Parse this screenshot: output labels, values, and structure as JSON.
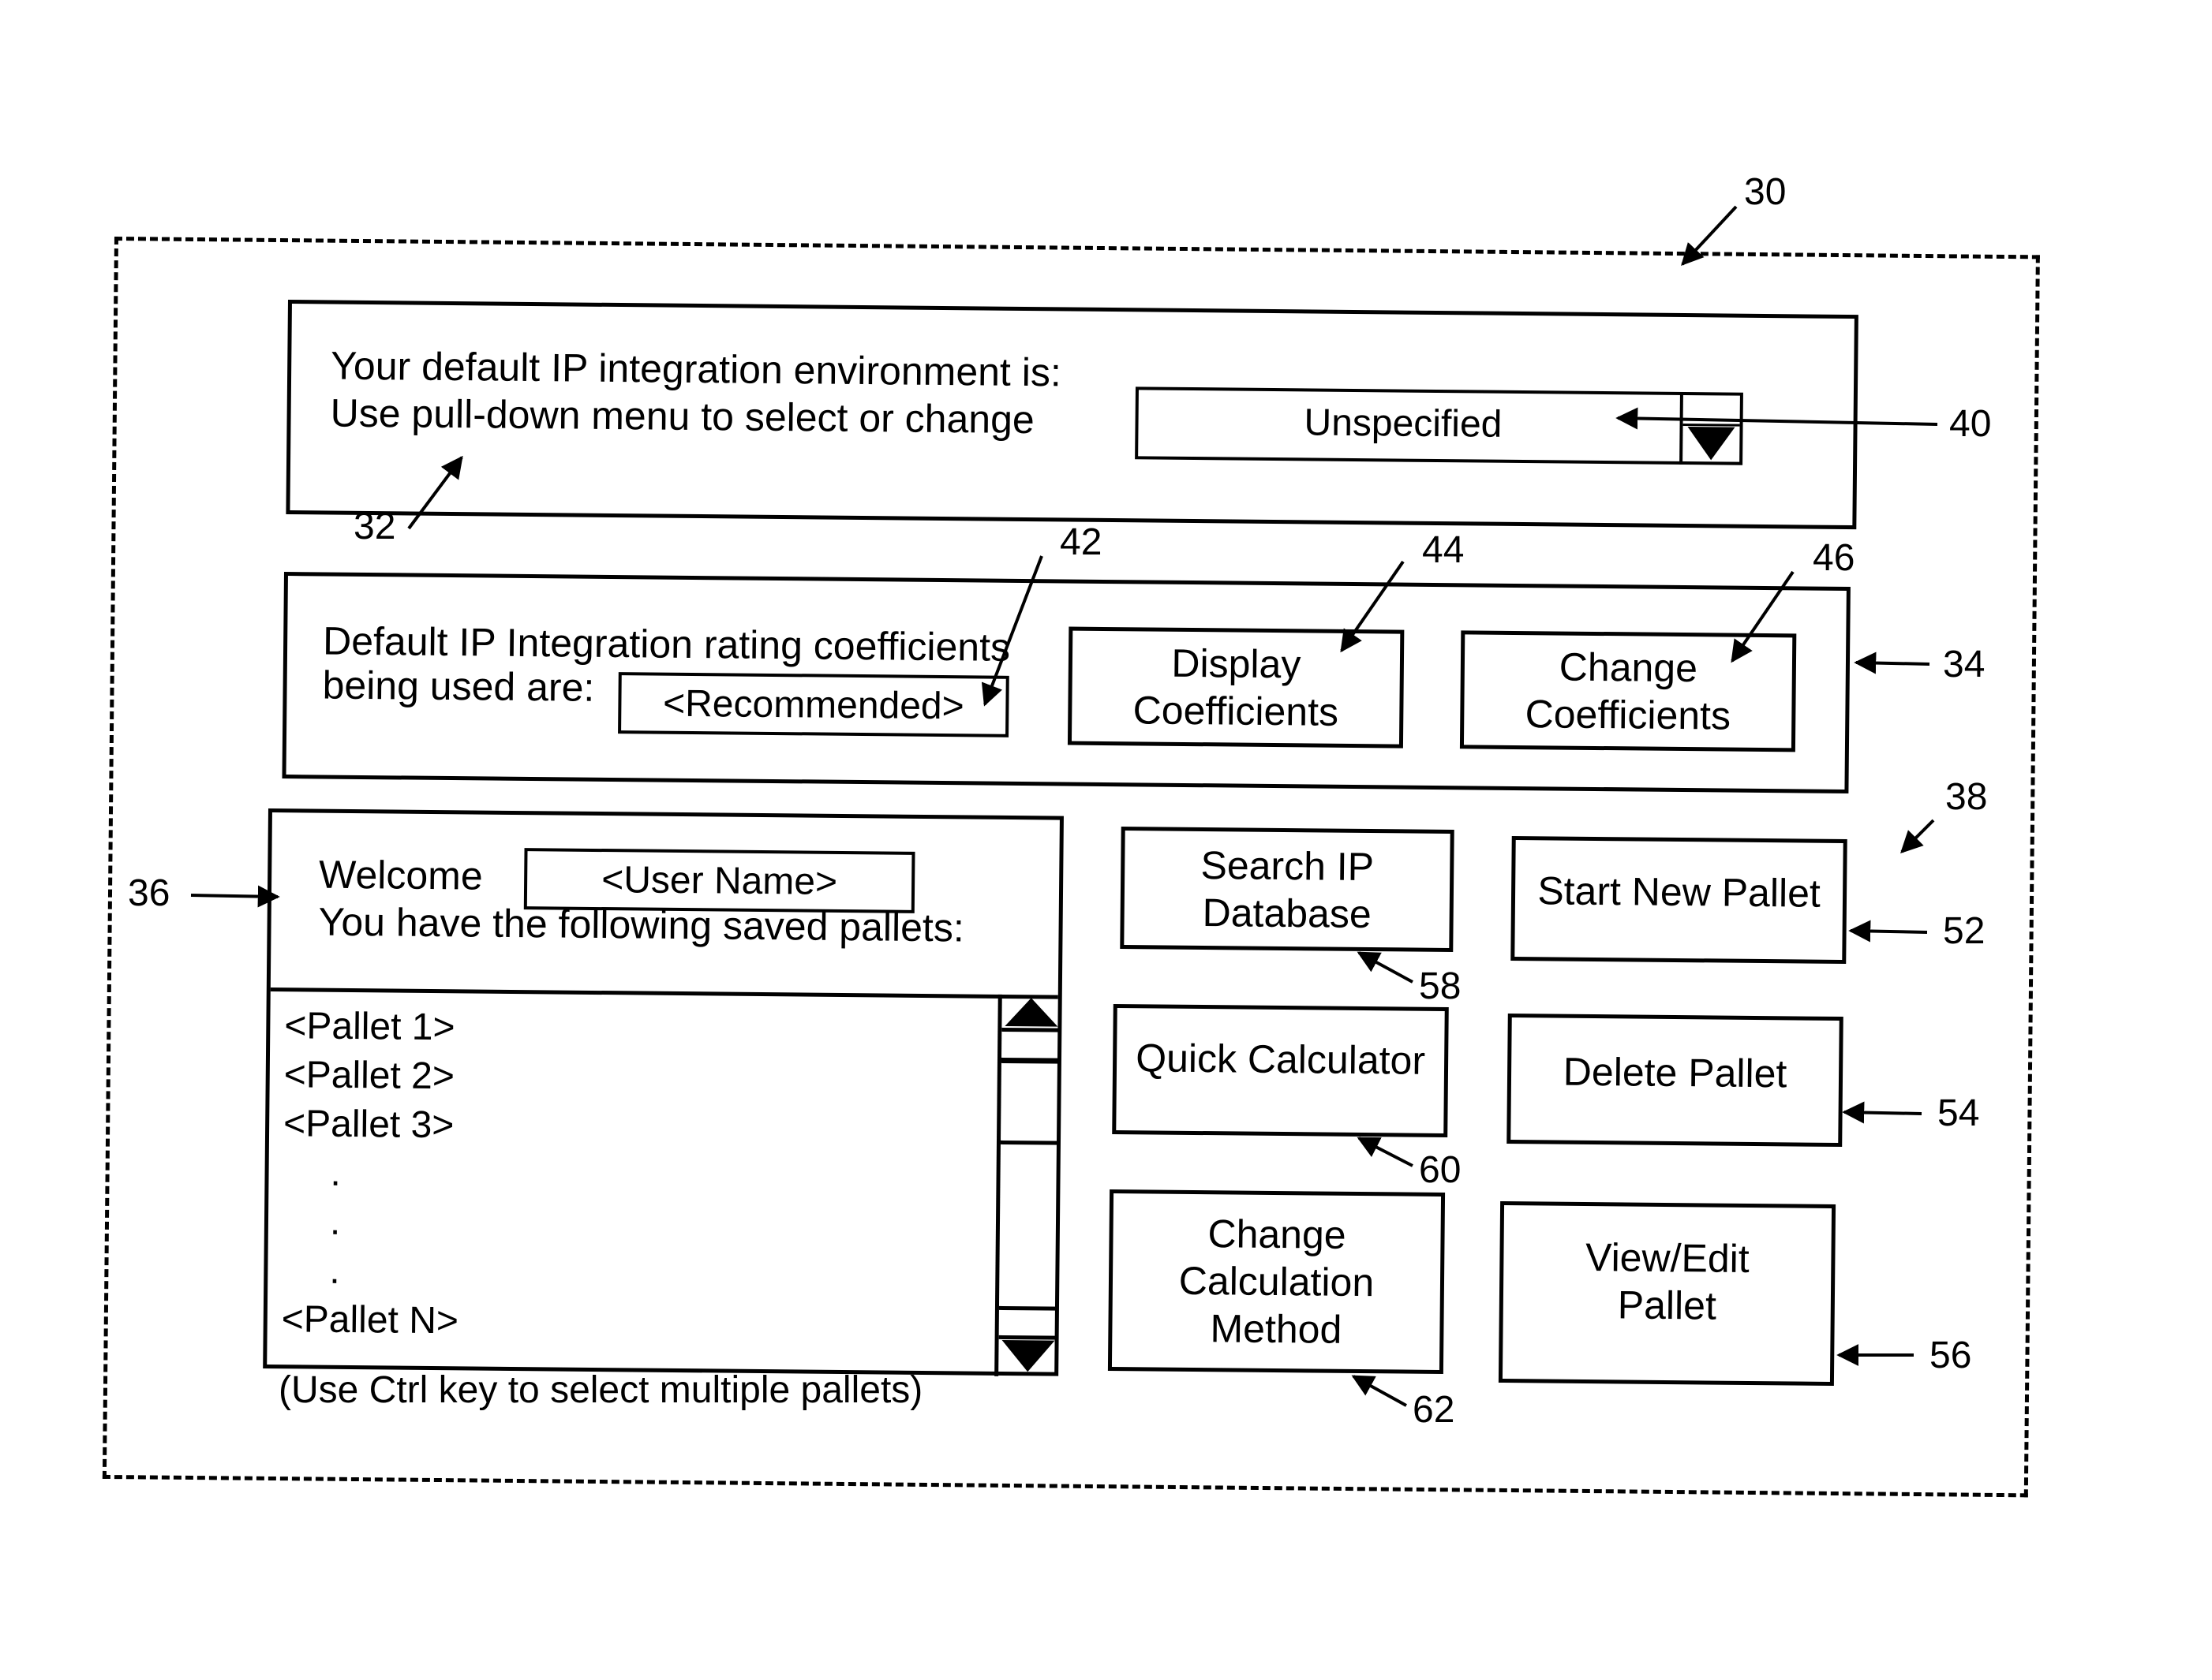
{
  "figure": {
    "ref_main": "30"
  },
  "environment_panel": {
    "ref": "32",
    "line1": "Your default IP integration environment is:",
    "line2": "Use pull-down menu to select or change",
    "dropdown": {
      "value": "Unspecified",
      "ref": "40",
      "icon": "triangle-down"
    }
  },
  "coefficients_panel": {
    "ref": "34",
    "line1": "Default IP Integration rating coefficients",
    "line2": "being used are:",
    "coeff_field": {
      "value": "<Recommended>",
      "ref": "42"
    },
    "display_button": {
      "line1": "Display",
      "line2": "Coefficients",
      "ref": "44"
    },
    "change_button": {
      "line1": "Change",
      "line2": "Coefficients",
      "ref": "46"
    }
  },
  "pallets_panel": {
    "ref": "36",
    "welcome_label": "Welcome",
    "user_name": "<User Name>",
    "saved_label": "You have the following saved pallets:",
    "items": [
      "<Pallet 1>",
      "<Pallet 2>",
      "<Pallet 3>",
      ".",
      ".",
      ".",
      "<Pallet N>"
    ],
    "hint": "(Use Ctrl key to select multiple pallets)",
    "scroll_up_icon": "triangle-up",
    "scroll_down_icon": "triangle-down"
  },
  "actions": {
    "ref_group": "38",
    "search_ip": {
      "line1": "Search IP",
      "line2": "Database",
      "ref": "58"
    },
    "quick_calculator": {
      "label": "Quick Calculator",
      "ref": "60"
    },
    "change_calc_method": {
      "line1": "Change",
      "line2": "Calculation",
      "line3": "Method",
      "ref": "62"
    },
    "start_new_pallet": {
      "label": "Start New Pallet",
      "ref": "52"
    },
    "delete_pallet": {
      "label": "Delete Pallet",
      "ref": "54"
    },
    "view_edit_pallet": {
      "line1": "View/Edit",
      "line2": "Pallet",
      "ref": "56"
    }
  }
}
